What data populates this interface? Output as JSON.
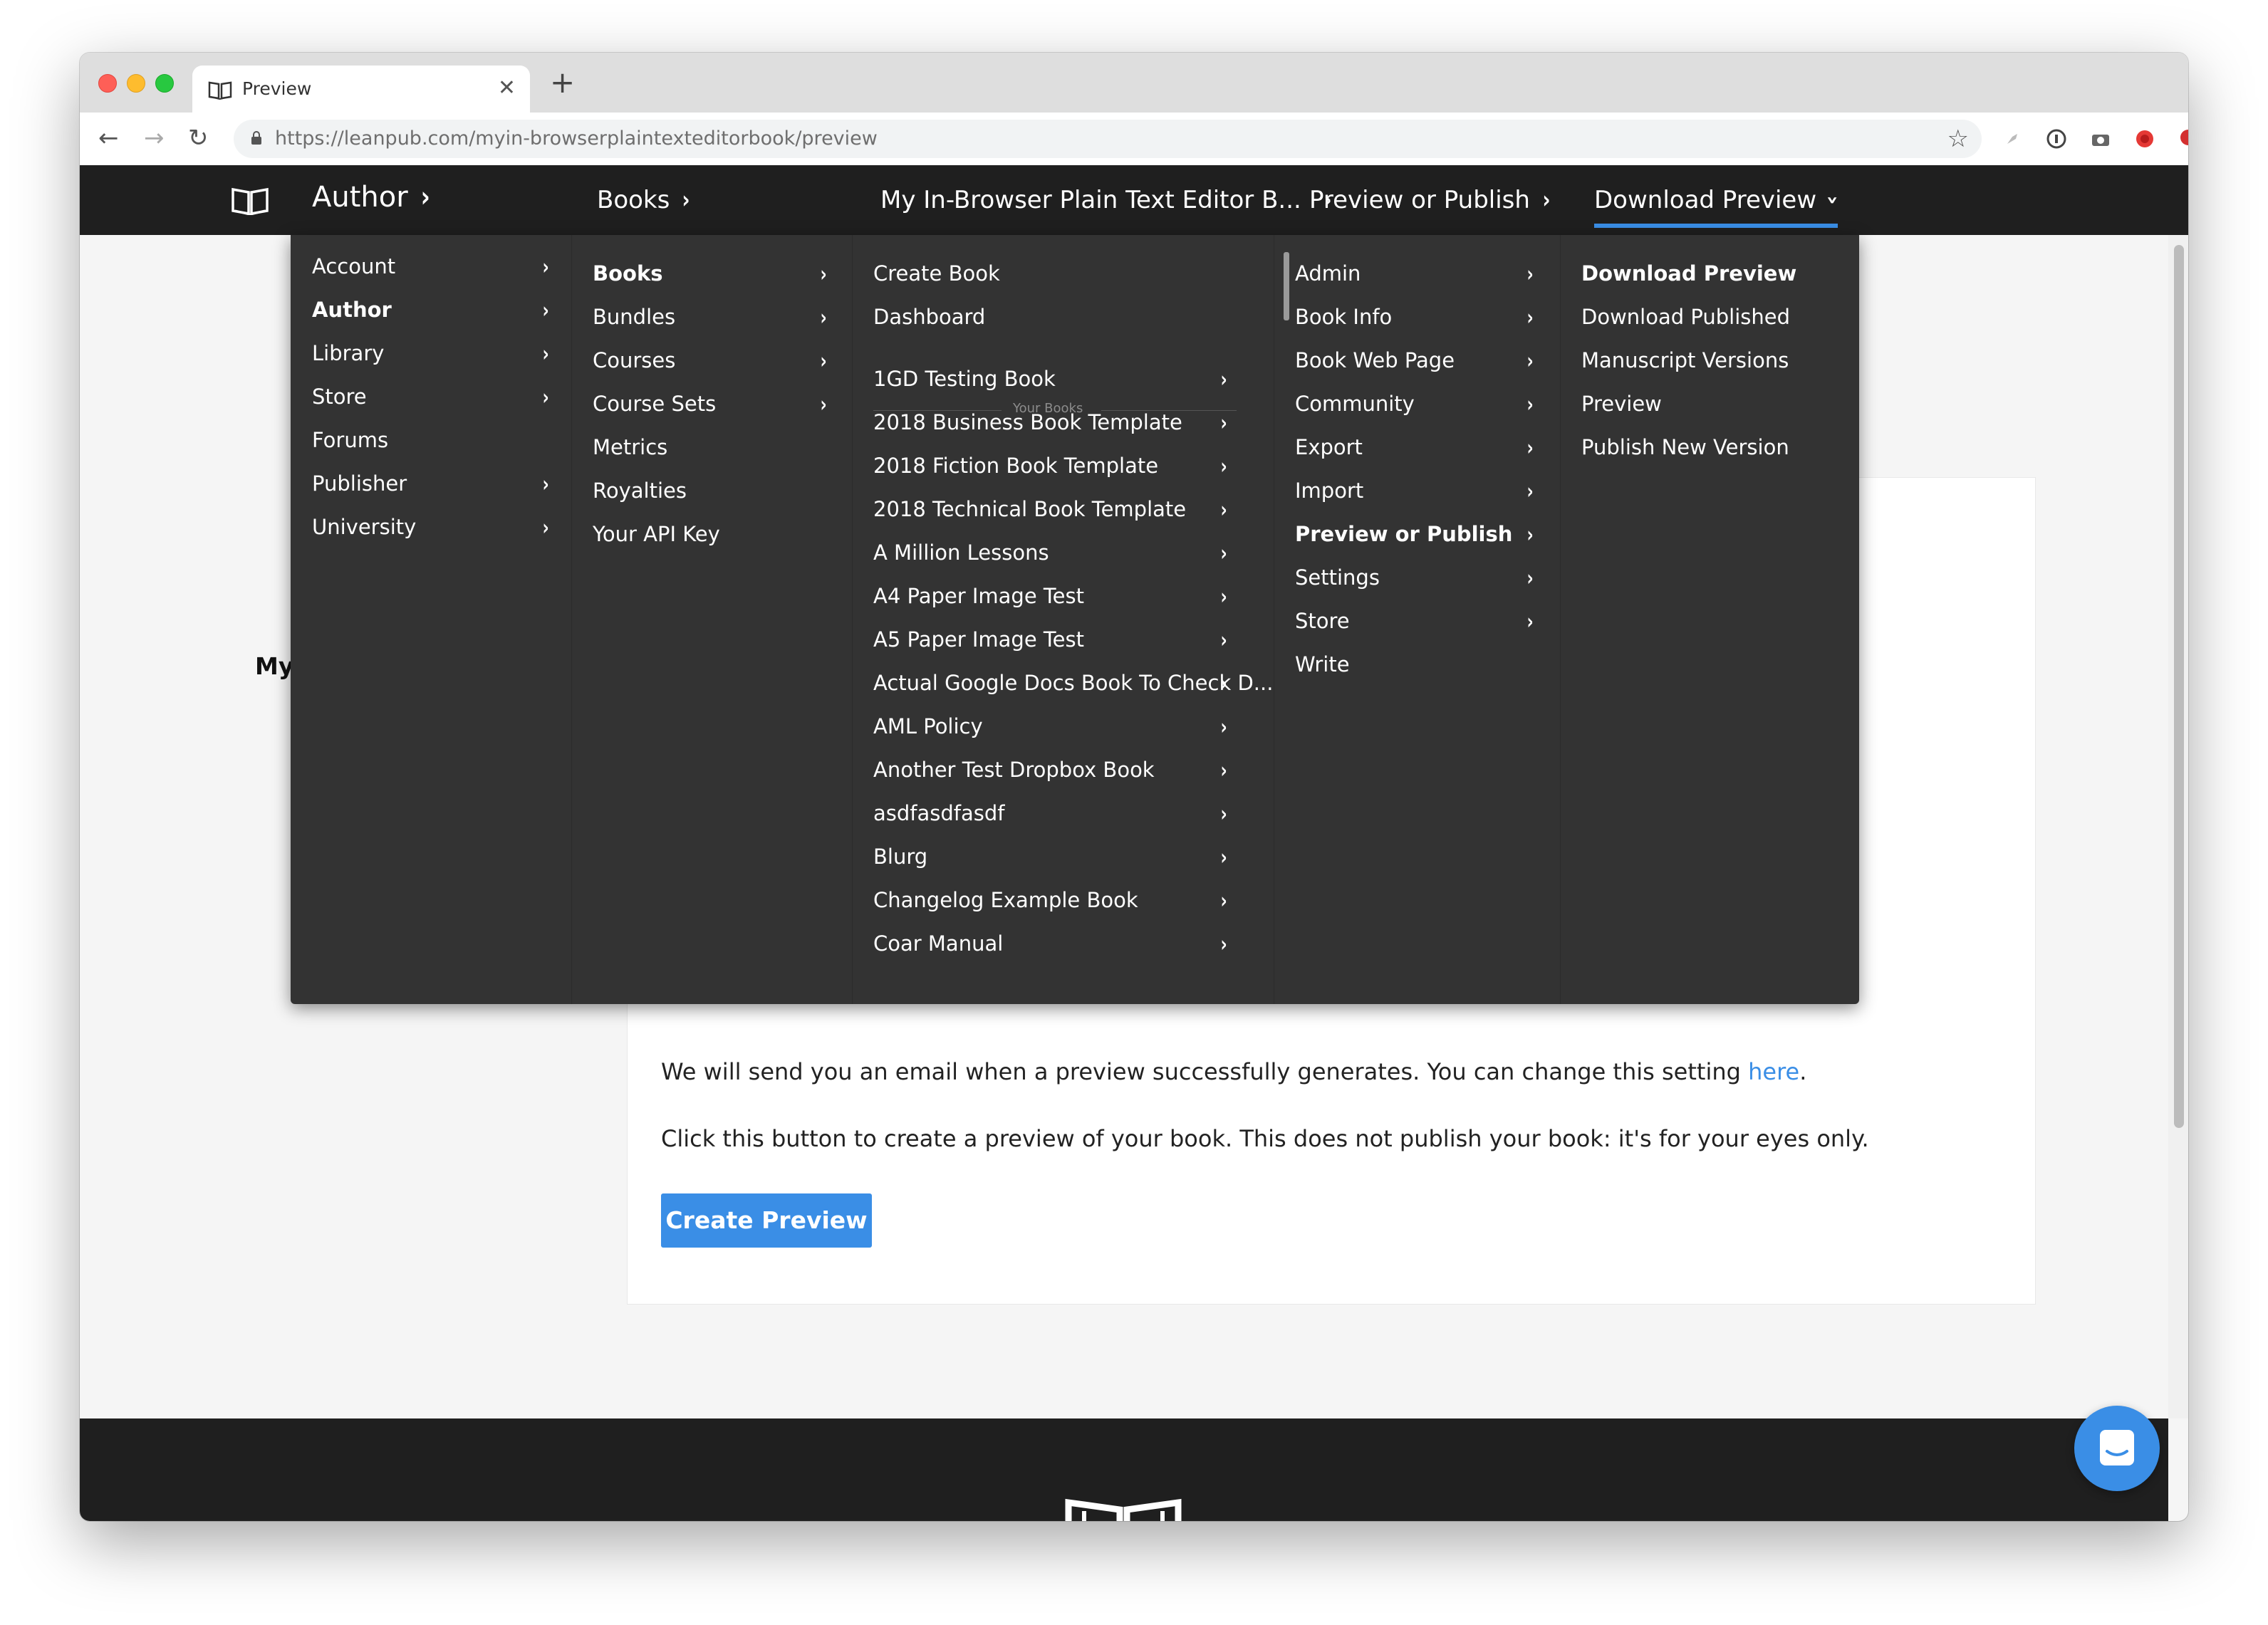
{
  "browser": {
    "tab_title": "Preview",
    "url_host": "https://leanpub.com",
    "url_path": "/myin-browserplaintexteditorbook/preview",
    "ext_badge": "1"
  },
  "site_header": {
    "crumbs": [
      "Author",
      "Books",
      "My In-Browser Plain Text Editor B...",
      "Preview or Publish",
      "Download Preview"
    ]
  },
  "menu": {
    "col1": [
      {
        "label": "Account",
        "chevron": true
      },
      {
        "label": "Author",
        "chevron": true,
        "active": true
      },
      {
        "label": "Library",
        "chevron": true
      },
      {
        "label": "Store",
        "chevron": true
      },
      {
        "label": "Forums",
        "chevron": false
      },
      {
        "label": "Publisher",
        "chevron": true
      },
      {
        "label": "University",
        "chevron": true
      }
    ],
    "col2": [
      {
        "label": "Books",
        "chevron": true,
        "active": true
      },
      {
        "label": "Bundles",
        "chevron": true
      },
      {
        "label": "Courses",
        "chevron": true
      },
      {
        "label": "Course Sets",
        "chevron": true
      },
      {
        "label": "Metrics",
        "chevron": false
      },
      {
        "label": "Royalties",
        "chevron": false
      },
      {
        "label": "Your API Key",
        "chevron": false
      }
    ],
    "col3_top": [
      {
        "label": "Create Book",
        "chevron": false
      },
      {
        "label": "Dashboard",
        "chevron": false
      }
    ],
    "col3_section": "Your Books",
    "col3_books": [
      "1GD Testing Book",
      "2018 Business Book Template",
      "2018 Fiction Book Template",
      "2018 Technical Book Template",
      "A Million Lessons",
      "A4 Paper Image Test",
      "A5 Paper Image Test",
      "Actual Google Docs Book To Check D...",
      "AML Policy",
      "Another Test Dropbox Book",
      "asdfasdfasdf",
      "Blurg",
      "Changelog Example Book",
      "Coar Manual"
    ],
    "col4": [
      {
        "label": "Admin",
        "chevron": true
      },
      {
        "label": "Book Info",
        "chevron": true
      },
      {
        "label": "Book Web Page",
        "chevron": true
      },
      {
        "label": "Community",
        "chevron": true
      },
      {
        "label": "Export",
        "chevron": true
      },
      {
        "label": "Import",
        "chevron": true
      },
      {
        "label": "Preview or Publish",
        "chevron": true,
        "active": true
      },
      {
        "label": "Settings",
        "chevron": true
      },
      {
        "label": "Store",
        "chevron": true
      },
      {
        "label": "Write",
        "chevron": false
      }
    ],
    "col5": [
      {
        "label": "Download Preview",
        "active": true
      },
      {
        "label": "Download Published"
      },
      {
        "label": "Manuscript Versions"
      },
      {
        "label": "Preview"
      },
      {
        "label": "Publish New Version"
      }
    ]
  },
  "page": {
    "partial_title": "My",
    "email_text": "We will send you an email when a preview successfully generates. You can change this setting ",
    "email_link": "here",
    "email_end": ".",
    "click_text": "Click this button to create a preview of your book. This does not publish your book: it's for your eyes only.",
    "create_button": "Create Preview"
  },
  "colors": {
    "accent": "#3a8ee6",
    "header_bg": "#1f1f1f",
    "menu_bg": "#333333"
  },
  "icons": {
    "logo": "open-book-icon",
    "chat": "chat-bubble-icon"
  }
}
